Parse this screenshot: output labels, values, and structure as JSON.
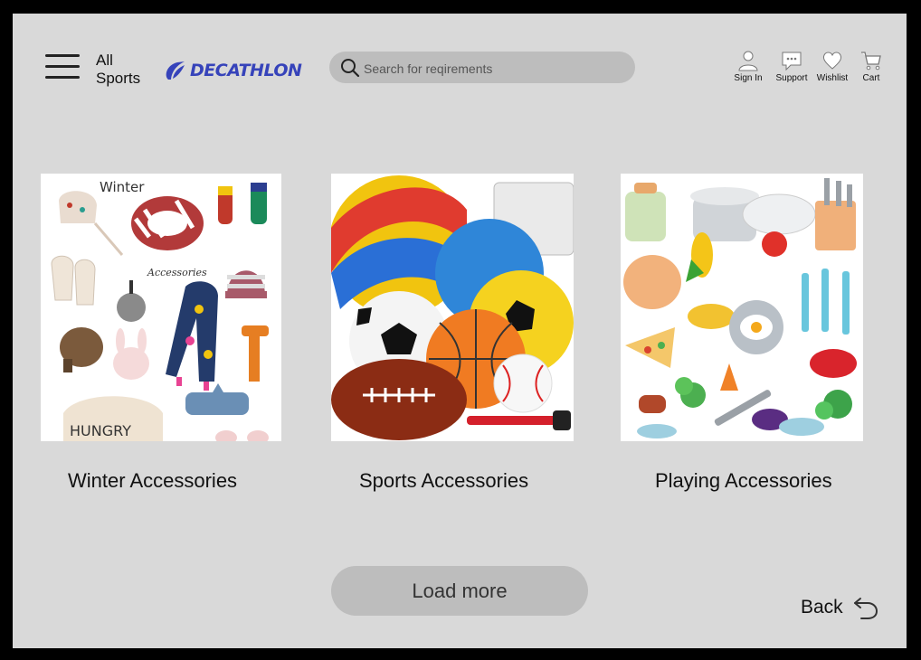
{
  "header": {
    "all_sports_line1": "All",
    "all_sports_line2": "Sports",
    "brand": "DECATHLON",
    "brand_color": "#3643ba"
  },
  "search": {
    "placeholder": "Search for reqirements",
    "value": ""
  },
  "actions": [
    {
      "label": "Sign In",
      "icon": "user-icon"
    },
    {
      "label": "Support",
      "icon": "chat-bubble-icon"
    },
    {
      "label": "Wishlist",
      "icon": "heart-icon"
    },
    {
      "label": "Cart",
      "icon": "cart-icon"
    }
  ],
  "cards": [
    {
      "title": "Winter Accessories",
      "image_text_1": "Winter",
      "image_text_2": "Accessories",
      "image_text_3": "HUNGRY"
    },
    {
      "title": "Sports Accessories"
    },
    {
      "title": "Playing Accessories"
    }
  ],
  "load_more_label": "Load more",
  "back_label": "Back",
  "colors": {
    "background": "#d9d9d9",
    "frame": "#000000",
    "control_fill": "#bdbdbd"
  }
}
